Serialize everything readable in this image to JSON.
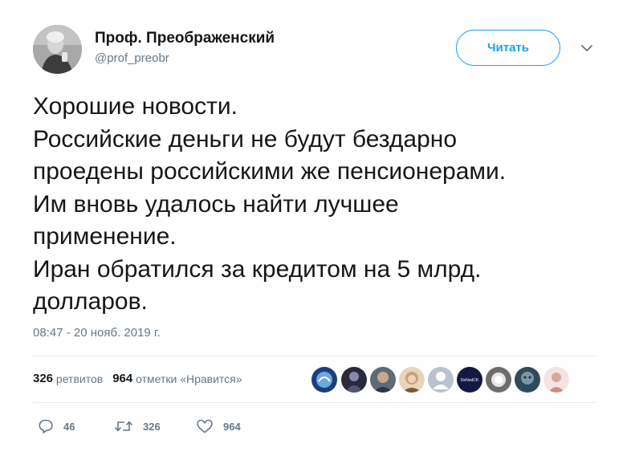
{
  "author": {
    "name": "Проф. Преображенский",
    "handle": "@prof_preobr"
  },
  "follow_button_label": "Читать",
  "tweet": {
    "lines": [
      "Хорошие новости.",
      "Российские деньги не будут бездарно",
      "проедены российскими же пенсионерами.",
      "Им вновь удалось найти лучшее",
      "применение.",
      "Иран обратился за кредитом на 5 млрд.",
      "долларов."
    ],
    "timestamp": "08:47 - 20 нояб. 2019 г."
  },
  "stats": {
    "retweets_count": "326",
    "retweets_label": "ретвитов",
    "likes_count": "964",
    "likes_label": "отметки «Нравится»"
  },
  "liker_avatars": [
    {
      "icon": "avatar-blue-circle-icon",
      "color": "#1a3f7a"
    },
    {
      "icon": "avatar-dark-figure-icon",
      "color": "#2a2a3a"
    },
    {
      "icon": "avatar-man-photo-icon",
      "color": "#5d6a78"
    },
    {
      "icon": "avatar-woman-photo-icon",
      "color": "#c9a27a"
    },
    {
      "icon": "avatar-default-gray-icon",
      "color": "#b8c3cc"
    },
    {
      "icon": "avatar-darkblue-logo-icon",
      "color": "#111a44"
    },
    {
      "icon": "avatar-dandelion-icon",
      "color": "#8a8a8a"
    },
    {
      "icon": "avatar-steel-face-icon",
      "color": "#2f4a5a"
    },
    {
      "icon": "avatar-pink-person-icon",
      "color": "#e8c8c4"
    }
  ],
  "liker_avatar_texts": {
    "darkblue_logo": "DeNedCK"
  },
  "actions": {
    "replies": "46",
    "retweets": "326",
    "likes": "964"
  },
  "colors": {
    "accent": "#1da1f2",
    "secondary_text": "#657786",
    "primary_text": "#14171a",
    "divider": "#e6ecf0"
  }
}
